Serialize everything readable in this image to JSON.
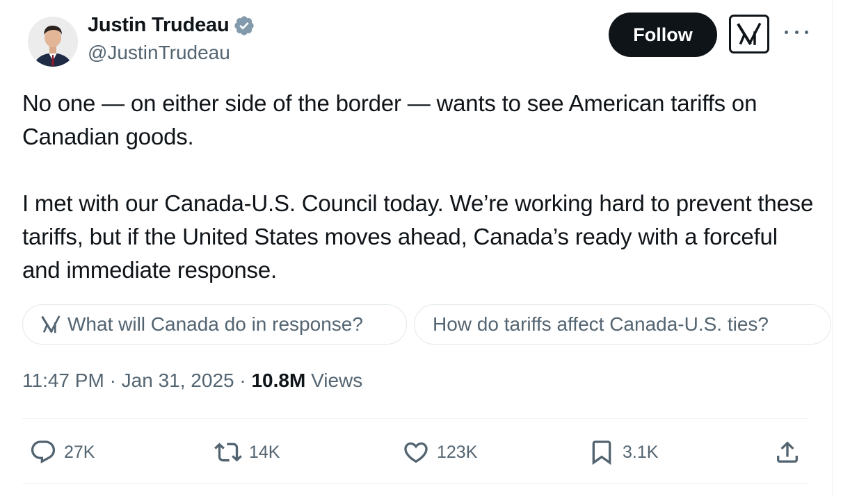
{
  "author": {
    "name": "Justin Trudeau",
    "handle": "@JustinTrudeau",
    "verified": true
  },
  "header": {
    "follow_label": "Follow",
    "grok_icon": "grok-icon",
    "more_icon": "more-icon"
  },
  "tweet": {
    "paragraph_1": "No one — on either side of the border — wants to see American tariffs on Canadian goods.",
    "paragraph_2": "I met with our Canada-U.S. Council today. We’re working hard to prevent these tariffs, but if the United States moves ahead, Canada’s ready with a forceful and immediate response."
  },
  "grok_suggestions": [
    "What will Canada do in response?",
    "How do tariffs affect Canada-U.S. ties?"
  ],
  "meta": {
    "time": "11:47 PM",
    "separator": "·",
    "date": "Jan 31, 2025",
    "views_count": "10.8M",
    "views_label": "Views"
  },
  "actions": {
    "replies": "27K",
    "reposts": "14K",
    "likes": "123K",
    "bookmarks": "3.1K"
  },
  "colors": {
    "text": "#0f1419",
    "secondary": "#536471",
    "verified": "#829aab",
    "follow_bg": "#0f1419"
  }
}
